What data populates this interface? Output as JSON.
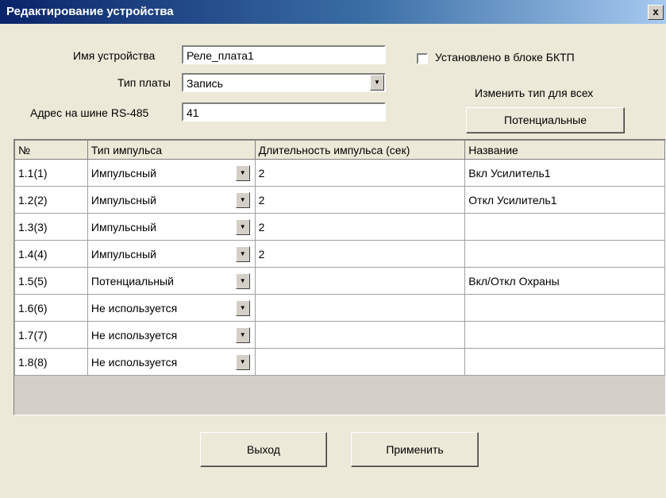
{
  "window": {
    "title": "Редактирование устройства",
    "close": "x"
  },
  "form": {
    "device_name_label": "Имя устройства",
    "device_name_value": "Реле_плата1",
    "board_type_label": "Тип платы",
    "board_type_value": "Запись",
    "rs485_label": "Адрес на шине RS-485",
    "rs485_value": "41",
    "installed_label": "Установлено в блоке БКТП",
    "installed_checked": false,
    "change_all_label": "Изменить тип для всех",
    "change_all_button": "Потенциальные"
  },
  "table": {
    "headers": [
      "№",
      "Тип импульса",
      "Длительность импульса (сек)",
      "Название"
    ],
    "rows": [
      {
        "num": "1.1(1)",
        "type": "Импульсный",
        "duration": "2",
        "name": "Вкл Усилитель1"
      },
      {
        "num": "1.2(2)",
        "type": "Импульсный",
        "duration": "2",
        "name": "Откл Усилитель1"
      },
      {
        "num": "1.3(3)",
        "type": "Импульсный",
        "duration": "2",
        "name": ""
      },
      {
        "num": "1.4(4)",
        "type": "Импульсный",
        "duration": "2",
        "name": ""
      },
      {
        "num": "1.5(5)",
        "type": "Потенциальный",
        "duration": "",
        "name": "Вкл/Откл Охраны"
      },
      {
        "num": "1.6(6)",
        "type": "Не используется",
        "duration": "",
        "name": ""
      },
      {
        "num": "1.7(7)",
        "type": "Не используется",
        "duration": "",
        "name": ""
      },
      {
        "num": "1.8(8)",
        "type": "Не используется",
        "duration": "",
        "name": ""
      }
    ]
  },
  "footer": {
    "exit_button": "Выход",
    "apply_button": "Применить"
  },
  "icons": {
    "dropdown": "dropdown-arrow-icon",
    "close": "close-icon"
  },
  "colors": {
    "titlebar_start": "#0a246a",
    "titlebar_end": "#a6caf0",
    "window_bg": "#ece9d8"
  }
}
